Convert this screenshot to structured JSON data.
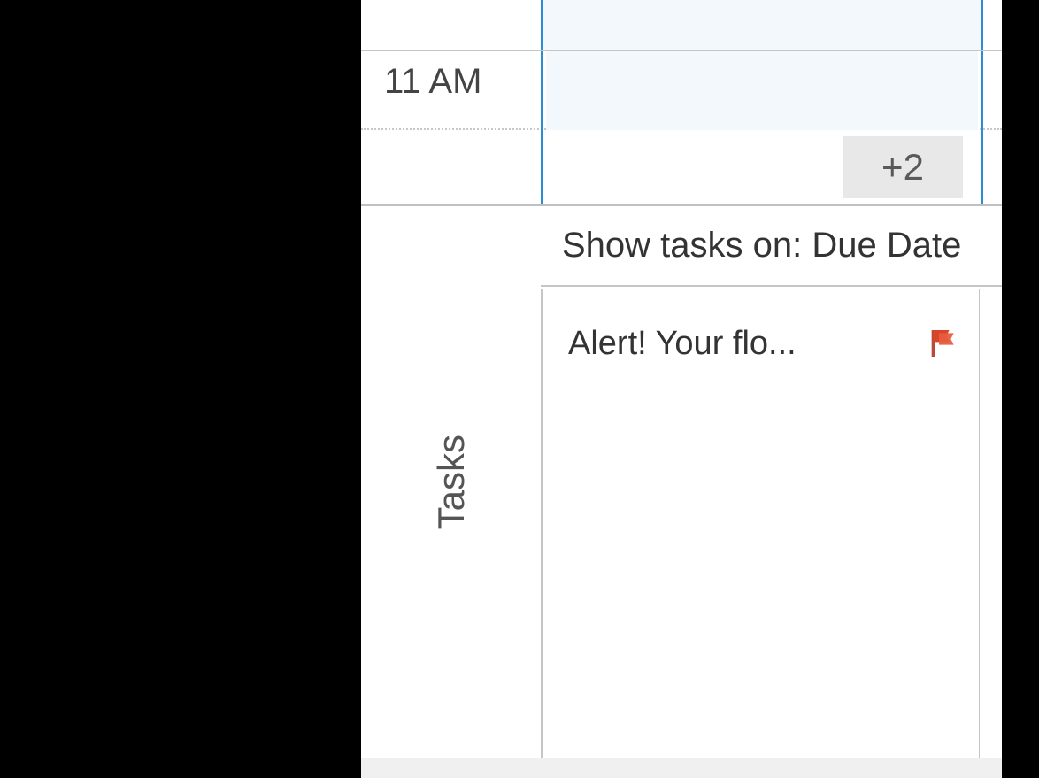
{
  "calendar": {
    "time_label": "11 AM",
    "more_count": "+2"
  },
  "tasks": {
    "section_label": "Tasks",
    "header": "Show tasks on: Due Date",
    "items": [
      {
        "text": "Alert! Your flo..."
      }
    ]
  }
}
